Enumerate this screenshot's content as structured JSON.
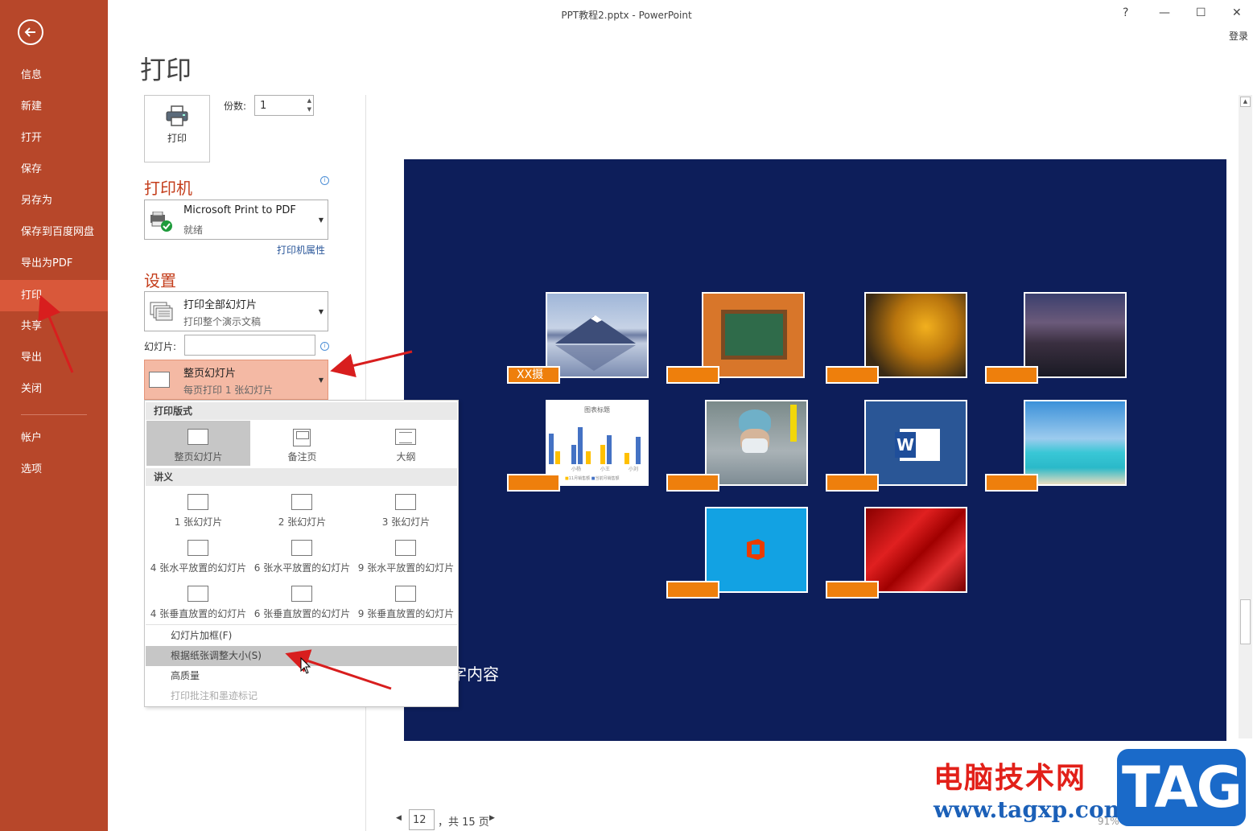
{
  "window": {
    "title": "PPT教程2.pptx - PowerPoint",
    "help": "?",
    "minimize": "—",
    "maximize": "☐",
    "close": "✕",
    "login": "登录"
  },
  "sidebar": {
    "items": [
      {
        "label": "信息"
      },
      {
        "label": "新建"
      },
      {
        "label": "打开"
      },
      {
        "label": "保存"
      },
      {
        "label": "另存为"
      },
      {
        "label": "保存到百度网盘"
      },
      {
        "label": "导出为PDF"
      },
      {
        "label": "打印"
      },
      {
        "label": "共享"
      },
      {
        "label": "导出"
      },
      {
        "label": "关闭"
      },
      {
        "label": "帐户"
      },
      {
        "label": "选项"
      }
    ],
    "active": "打印",
    "bg_color": "#b7472a",
    "active_color": "#d9583a"
  },
  "main": {
    "page_title": "打印",
    "print_button_label": "打印",
    "copies_label": "份数:",
    "copies_value": "1",
    "printer_heading": "打印机",
    "printer_name": "Microsoft Print to PDF",
    "printer_status": "就绪",
    "printer_properties_link": "打印机属性",
    "settings_heading": "设置",
    "range_main": "打印全部幻灯片",
    "range_sub": "打印整个演示文稿",
    "slides_label": "幻灯片:",
    "slides_value": "",
    "layout_main": "整页幻灯片",
    "layout_sub": "每页打印 1 张幻灯片",
    "info_glyph": "i"
  },
  "menu": {
    "section_layout": "打印版式",
    "layout_options": [
      {
        "label": "整页幻灯片",
        "selected": true
      },
      {
        "label": "备注页",
        "selected": false
      },
      {
        "label": "大纲",
        "selected": false
      }
    ],
    "section_handouts": "讲义",
    "handout_options": [
      {
        "label": "1 张幻灯片"
      },
      {
        "label": "2 张幻灯片"
      },
      {
        "label": "3 张幻灯片"
      },
      {
        "label": "4 张水平放置的幻灯片"
      },
      {
        "label": "6 张水平放置的幻灯片"
      },
      {
        "label": "9 张水平放置的幻灯片"
      },
      {
        "label": "4 张垂直放置的幻灯片"
      },
      {
        "label": "6 张垂直放置的幻灯片"
      },
      {
        "label": "9 张垂直放置的幻灯片"
      }
    ],
    "items": [
      {
        "label": "幻灯片加框(F)"
      },
      {
        "label": "根据纸张调整大小(S)"
      },
      {
        "label": "高质量"
      },
      {
        "label": "打印批注和墨迹标记"
      }
    ]
  },
  "preview": {
    "slide_bg": "#0d1e5a",
    "tag_color": "#ee7f0c",
    "first_tag": "XX摄",
    "slide_text": "字内容",
    "chart_title": "图表标题",
    "chart_ticks": [
      "小杨",
      "小王",
      "小刘"
    ],
    "chart_legend": [
      "11月销售额",
      "当前月销售额"
    ],
    "word_letter": "W",
    "thumbs": [
      "mountain-lake-photo",
      "autumn-blackboard-photo",
      "yellow-maple-leaf-photo",
      "city-night-photo",
      "bar-chart-image",
      "doctor-photo",
      "word-logo-image",
      "beach-photo",
      "office-logo-image",
      "red-silk-photo"
    ]
  },
  "page_nav": {
    "current_page": "12",
    "total_text": "，共 15 页",
    "prev": "◀",
    "next": "▶"
  },
  "watermark": {
    "site_name": "电脑技术网",
    "url": "www.tagxp.com",
    "badge": "TAG",
    "zoom": "91%"
  }
}
